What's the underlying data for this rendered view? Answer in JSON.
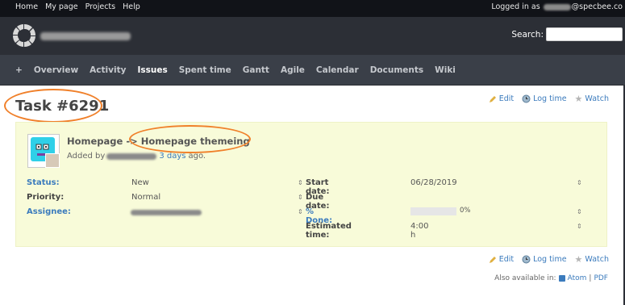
{
  "top_menu": {
    "items": [
      "Home",
      "My page",
      "Projects",
      "Help"
    ],
    "logged_prefix": "Logged in as",
    "logged_suffix": "@specbee.co"
  },
  "header": {
    "search_label": "Search:"
  },
  "main_menu": {
    "items": [
      "+",
      "Overview",
      "Activity",
      "Issues",
      "Spent time",
      "Gantt",
      "Agile",
      "Calendar",
      "Documents",
      "Wiki"
    ],
    "selected": "Issues"
  },
  "issue": {
    "title": "Task #6291",
    "subject_prefix": "Homepage -> ",
    "subject": "Homepage themeing",
    "added_by": "Added by",
    "time_ago": "3 days",
    "ago": "ago.",
    "attributes": {
      "status_label": "Status:",
      "status_value": "New",
      "priority_label": "Priority:",
      "priority_value": "Normal",
      "assignee_label": "Assignee:",
      "start_label": "Start date:",
      "start_value": "06/28/2019",
      "due_label": "Due date:",
      "done_label": "% Done:",
      "done_value": "0%",
      "done_percent": 0,
      "estimated_label": "Estimated time:",
      "estimated_value": "4:00 h"
    }
  },
  "actions": {
    "edit": "Edit",
    "log_time": "Log time",
    "watch": "Watch"
  },
  "footer": {
    "also_available": "Also available in:",
    "atom": "Atom",
    "separator": "|",
    "pdf": "PDF"
  },
  "colors": {
    "accent": "#3b7bbd",
    "highlight": "#f0802a",
    "issue_bg": "#f8fbd9"
  }
}
